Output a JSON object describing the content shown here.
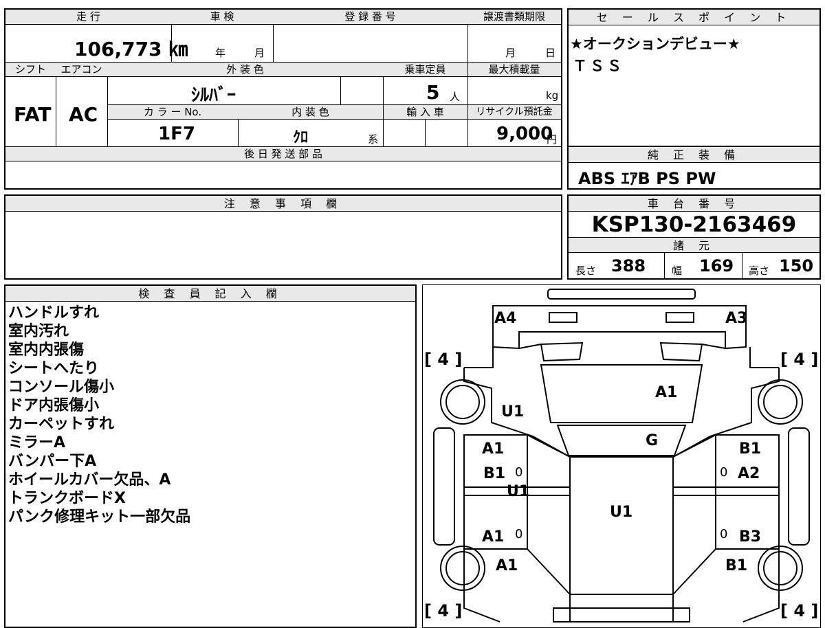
{
  "specs": {
    "mileage_label": "走 行",
    "mileage_value": "106,773 ㎞",
    "inspection_label": "車 検",
    "inspection_year": "年",
    "inspection_month": "月",
    "registration_label": "登 録 番 号",
    "transfer_label": "譲渡書類期限",
    "transfer_month": "月",
    "transfer_day": "日",
    "shift_label": "シフト",
    "shift_value": "FAT",
    "ac_label": "エアコン",
    "ac_value": "AC",
    "exterior_label": "外 装 色",
    "exterior_value": "ｼﾙﾊﾞｰ",
    "capacity_label": "乗車定員",
    "capacity_value": "5",
    "capacity_unit": "人",
    "maxload_label": "最大積載量",
    "maxload_unit": "kg",
    "color_no_label": "カ ラ ー No.",
    "color_no_value": "1F7",
    "interior_label": "内 装 色",
    "interior_value": "ｸﾛ",
    "interior_suffix": "系",
    "import_label": "輸 入 車",
    "recycle_label": "リサイクル預託金",
    "recycle_value": "9,000",
    "recycle_unit": "円",
    "later_parts_label": "後 日 発 送 部 品"
  },
  "sales": {
    "label": "セ ー ル ス ポ イ ン ト",
    "lines": [
      "★オークションデビュー★",
      "ＴＳＳ"
    ]
  },
  "equipment": {
    "label": "純 正 装 備",
    "value": "ABS ｴｱB PS PW"
  },
  "notes": {
    "label": "注 意 事 項 欄"
  },
  "chassis": {
    "label": "車 台 番 号",
    "value": "KSP130-2163469",
    "dims_label": "諸 元",
    "length_label": "長さ",
    "length_value": "388",
    "width_label": "幅",
    "width_value": "169",
    "height_label": "高さ",
    "height_value": "150"
  },
  "inspector": {
    "label": "検 査 員 記 入 欄",
    "lines": [
      "ハンドルすれ",
      "室内汚れ",
      "室内内張傷",
      "シートへたり",
      "コンソール傷小",
      "ドア内張傷小",
      "カーペットすれ",
      "ミラーA",
      "バンパー下A",
      "ホイールカバー欠品、A",
      "トランクボードX",
      "パンク修理キット一部欠品"
    ]
  },
  "diagram": {
    "tire_tl": "[ 4 ]",
    "tire_tr": "[ 4 ]",
    "tire_bl": "[ 4 ]",
    "tire_br": "[ 4 ]",
    "marks": {
      "a4": "A4",
      "a3": "A3",
      "hood_a1": "A1",
      "left_u1": "U1",
      "roof_g": "G",
      "fl_a1": "A1",
      "fl_b1": "B1",
      "fl_zero": "0",
      "mid_u1": "U1",
      "roof_u1": "U1",
      "rl_a1": "A1",
      "rl_zero": "0",
      "rear_a1": "A1",
      "fr_b1": "B1",
      "fr_a2": "A2",
      "fr_zero": "0",
      "rr_b3": "B3",
      "rr_zero": "0",
      "rear_b1": "B1"
    }
  }
}
